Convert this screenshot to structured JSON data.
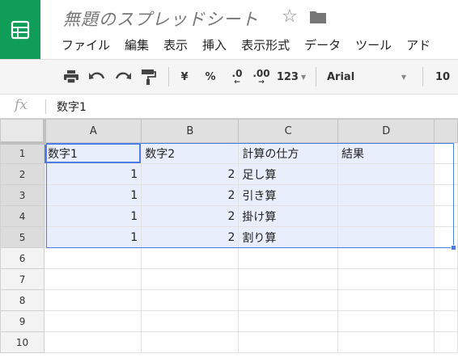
{
  "app": {
    "title": "無題のスプレッドシート",
    "icons": {
      "logo": "sheets-logo-icon",
      "star": "star-icon",
      "folder": "folder-icon"
    },
    "colors": {
      "brand": "#0f9d58",
      "selection": "#4d7ce8",
      "selection_fill": "#e9eefc"
    }
  },
  "menu": [
    "ファイル",
    "編集",
    "表示",
    "挿入",
    "表示形式",
    "データ",
    "ツール",
    "アド"
  ],
  "toolbar": {
    "currency": "¥",
    "percent": "%",
    "decrease_decimal": ".0",
    "increase_decimal": ".00",
    "more_formats": "123",
    "font": "Arial",
    "font_size": "10"
  },
  "formula_bar": {
    "fx": "fx",
    "value": "数字1"
  },
  "grid": {
    "columns": [
      "A",
      "B",
      "C",
      "D"
    ],
    "row_numbers": [
      "1",
      "2",
      "3",
      "4",
      "5",
      "6",
      "7",
      "8",
      "9",
      "10"
    ],
    "rows": [
      [
        "数字1",
        "数字2",
        "計算の仕方",
        "結果"
      ],
      [
        "1",
        "2",
        "足し算",
        ""
      ],
      [
        "1",
        "2",
        "引き算",
        ""
      ],
      [
        "1",
        "2",
        "掛け算",
        ""
      ],
      [
        "1",
        "2",
        "割り算",
        ""
      ],
      [
        "",
        "",
        "",
        ""
      ],
      [
        "",
        "",
        "",
        ""
      ],
      [
        "",
        "",
        "",
        ""
      ],
      [
        "",
        "",
        "",
        ""
      ],
      [
        "",
        "",
        "",
        ""
      ]
    ]
  }
}
